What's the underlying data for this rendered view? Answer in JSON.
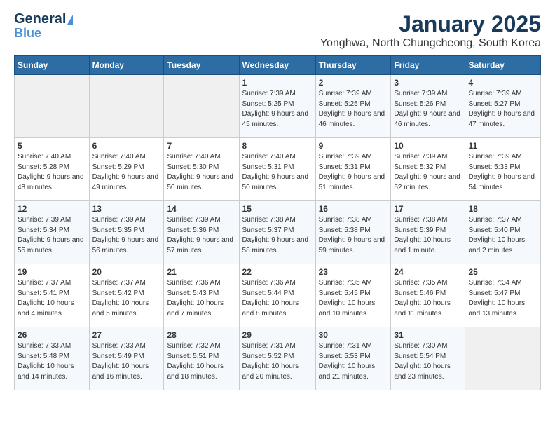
{
  "logo": {
    "line1": "General",
    "line2": "Blue"
  },
  "title": "January 2025",
  "subtitle": "Yonghwa, North Chungcheong, South Korea",
  "weekdays": [
    "Sunday",
    "Monday",
    "Tuesday",
    "Wednesday",
    "Thursday",
    "Friday",
    "Saturday"
  ],
  "weeks": [
    [
      {
        "day": "",
        "info": ""
      },
      {
        "day": "",
        "info": ""
      },
      {
        "day": "",
        "info": ""
      },
      {
        "day": "1",
        "info": "Sunrise: 7:39 AM\nSunset: 5:25 PM\nDaylight: 9 hours and 45 minutes."
      },
      {
        "day": "2",
        "info": "Sunrise: 7:39 AM\nSunset: 5:25 PM\nDaylight: 9 hours and 46 minutes."
      },
      {
        "day": "3",
        "info": "Sunrise: 7:39 AM\nSunset: 5:26 PM\nDaylight: 9 hours and 46 minutes."
      },
      {
        "day": "4",
        "info": "Sunrise: 7:39 AM\nSunset: 5:27 PM\nDaylight: 9 hours and 47 minutes."
      }
    ],
    [
      {
        "day": "5",
        "info": "Sunrise: 7:40 AM\nSunset: 5:28 PM\nDaylight: 9 hours and 48 minutes."
      },
      {
        "day": "6",
        "info": "Sunrise: 7:40 AM\nSunset: 5:29 PM\nDaylight: 9 hours and 49 minutes."
      },
      {
        "day": "7",
        "info": "Sunrise: 7:40 AM\nSunset: 5:30 PM\nDaylight: 9 hours and 50 minutes."
      },
      {
        "day": "8",
        "info": "Sunrise: 7:40 AM\nSunset: 5:31 PM\nDaylight: 9 hours and 50 minutes."
      },
      {
        "day": "9",
        "info": "Sunrise: 7:39 AM\nSunset: 5:31 PM\nDaylight: 9 hours and 51 minutes."
      },
      {
        "day": "10",
        "info": "Sunrise: 7:39 AM\nSunset: 5:32 PM\nDaylight: 9 hours and 52 minutes."
      },
      {
        "day": "11",
        "info": "Sunrise: 7:39 AM\nSunset: 5:33 PM\nDaylight: 9 hours and 54 minutes."
      }
    ],
    [
      {
        "day": "12",
        "info": "Sunrise: 7:39 AM\nSunset: 5:34 PM\nDaylight: 9 hours and 55 minutes."
      },
      {
        "day": "13",
        "info": "Sunrise: 7:39 AM\nSunset: 5:35 PM\nDaylight: 9 hours and 56 minutes."
      },
      {
        "day": "14",
        "info": "Sunrise: 7:39 AM\nSunset: 5:36 PM\nDaylight: 9 hours and 57 minutes."
      },
      {
        "day": "15",
        "info": "Sunrise: 7:38 AM\nSunset: 5:37 PM\nDaylight: 9 hours and 58 minutes."
      },
      {
        "day": "16",
        "info": "Sunrise: 7:38 AM\nSunset: 5:38 PM\nDaylight: 9 hours and 59 minutes."
      },
      {
        "day": "17",
        "info": "Sunrise: 7:38 AM\nSunset: 5:39 PM\nDaylight: 10 hours and 1 minute."
      },
      {
        "day": "18",
        "info": "Sunrise: 7:37 AM\nSunset: 5:40 PM\nDaylight: 10 hours and 2 minutes."
      }
    ],
    [
      {
        "day": "19",
        "info": "Sunrise: 7:37 AM\nSunset: 5:41 PM\nDaylight: 10 hours and 4 minutes."
      },
      {
        "day": "20",
        "info": "Sunrise: 7:37 AM\nSunset: 5:42 PM\nDaylight: 10 hours and 5 minutes."
      },
      {
        "day": "21",
        "info": "Sunrise: 7:36 AM\nSunset: 5:43 PM\nDaylight: 10 hours and 7 minutes."
      },
      {
        "day": "22",
        "info": "Sunrise: 7:36 AM\nSunset: 5:44 PM\nDaylight: 10 hours and 8 minutes."
      },
      {
        "day": "23",
        "info": "Sunrise: 7:35 AM\nSunset: 5:45 PM\nDaylight: 10 hours and 10 minutes."
      },
      {
        "day": "24",
        "info": "Sunrise: 7:35 AM\nSunset: 5:46 PM\nDaylight: 10 hours and 11 minutes."
      },
      {
        "day": "25",
        "info": "Sunrise: 7:34 AM\nSunset: 5:47 PM\nDaylight: 10 hours and 13 minutes."
      }
    ],
    [
      {
        "day": "26",
        "info": "Sunrise: 7:33 AM\nSunset: 5:48 PM\nDaylight: 10 hours and 14 minutes."
      },
      {
        "day": "27",
        "info": "Sunrise: 7:33 AM\nSunset: 5:49 PM\nDaylight: 10 hours and 16 minutes."
      },
      {
        "day": "28",
        "info": "Sunrise: 7:32 AM\nSunset: 5:51 PM\nDaylight: 10 hours and 18 minutes."
      },
      {
        "day": "29",
        "info": "Sunrise: 7:31 AM\nSunset: 5:52 PM\nDaylight: 10 hours and 20 minutes."
      },
      {
        "day": "30",
        "info": "Sunrise: 7:31 AM\nSunset: 5:53 PM\nDaylight: 10 hours and 21 minutes."
      },
      {
        "day": "31",
        "info": "Sunrise: 7:30 AM\nSunset: 5:54 PM\nDaylight: 10 hours and 23 minutes."
      },
      {
        "day": "",
        "info": ""
      }
    ]
  ]
}
